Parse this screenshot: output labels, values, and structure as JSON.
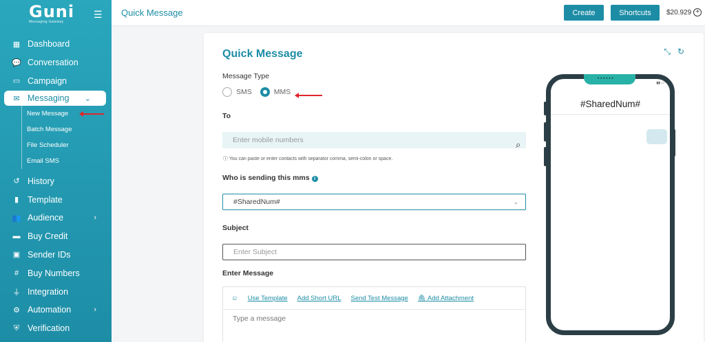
{
  "brand": {
    "logo_text": "Guni",
    "logo_sub": "Messaging Gateway"
  },
  "sidebar": {
    "items": [
      {
        "label": "Dashboard",
        "icon": "grid-icon"
      },
      {
        "label": "Conversation",
        "icon": "chat-icon"
      },
      {
        "label": "Campaign",
        "icon": "campaign-icon"
      },
      {
        "label": "Messaging",
        "icon": "message-icon",
        "active": true
      },
      {
        "label": "History",
        "icon": "history-icon"
      },
      {
        "label": "Template",
        "icon": "file-icon"
      },
      {
        "label": "Audience",
        "icon": "users-icon"
      },
      {
        "label": "Buy Credit",
        "icon": "card-icon"
      },
      {
        "label": "Sender IDs",
        "icon": "id-icon"
      },
      {
        "label": "Buy Numbers",
        "icon": "hash-icon"
      },
      {
        "label": "Integration",
        "icon": "plug-icon"
      },
      {
        "label": "Automation",
        "icon": "gear-icon"
      },
      {
        "label": "Verification",
        "icon": "shield-icon"
      }
    ],
    "sub_items": [
      "New Message",
      "Batch Message",
      "File Scheduler",
      "Email SMS"
    ]
  },
  "topbar": {
    "title": "Quick Message",
    "create_label": "Create",
    "shortcuts_label": "Shortcuts",
    "balance": "$20.929"
  },
  "form": {
    "title": "Quick Message",
    "message_type_label": "Message Type",
    "sms_label": "SMS",
    "mms_label": "MMS",
    "selected_type": "MMS",
    "to_label": "To",
    "to_placeholder": "Enter mobile numbers",
    "hint": "ⓘ You can paste or enter contacts with separator comma, semi-colon or space.",
    "sender_label": "Who is sending this mms",
    "sender_value": "#SharedNum#",
    "subject_label": "Subject",
    "subject_placeholder": "Enter Subject",
    "message_label": "Enter Message",
    "toolbar": {
      "use_template": "Use Template",
      "add_short_url": "Add Short URL",
      "send_test": "Send Test Message",
      "add_attachment": "Add Attachment"
    },
    "message_placeholder": "Type a message"
  },
  "preview": {
    "header": "#SharedNum#"
  },
  "colors": {
    "accent": "#1d8da6",
    "arrow": "#e0252b",
    "notch": "#28b1a6"
  }
}
